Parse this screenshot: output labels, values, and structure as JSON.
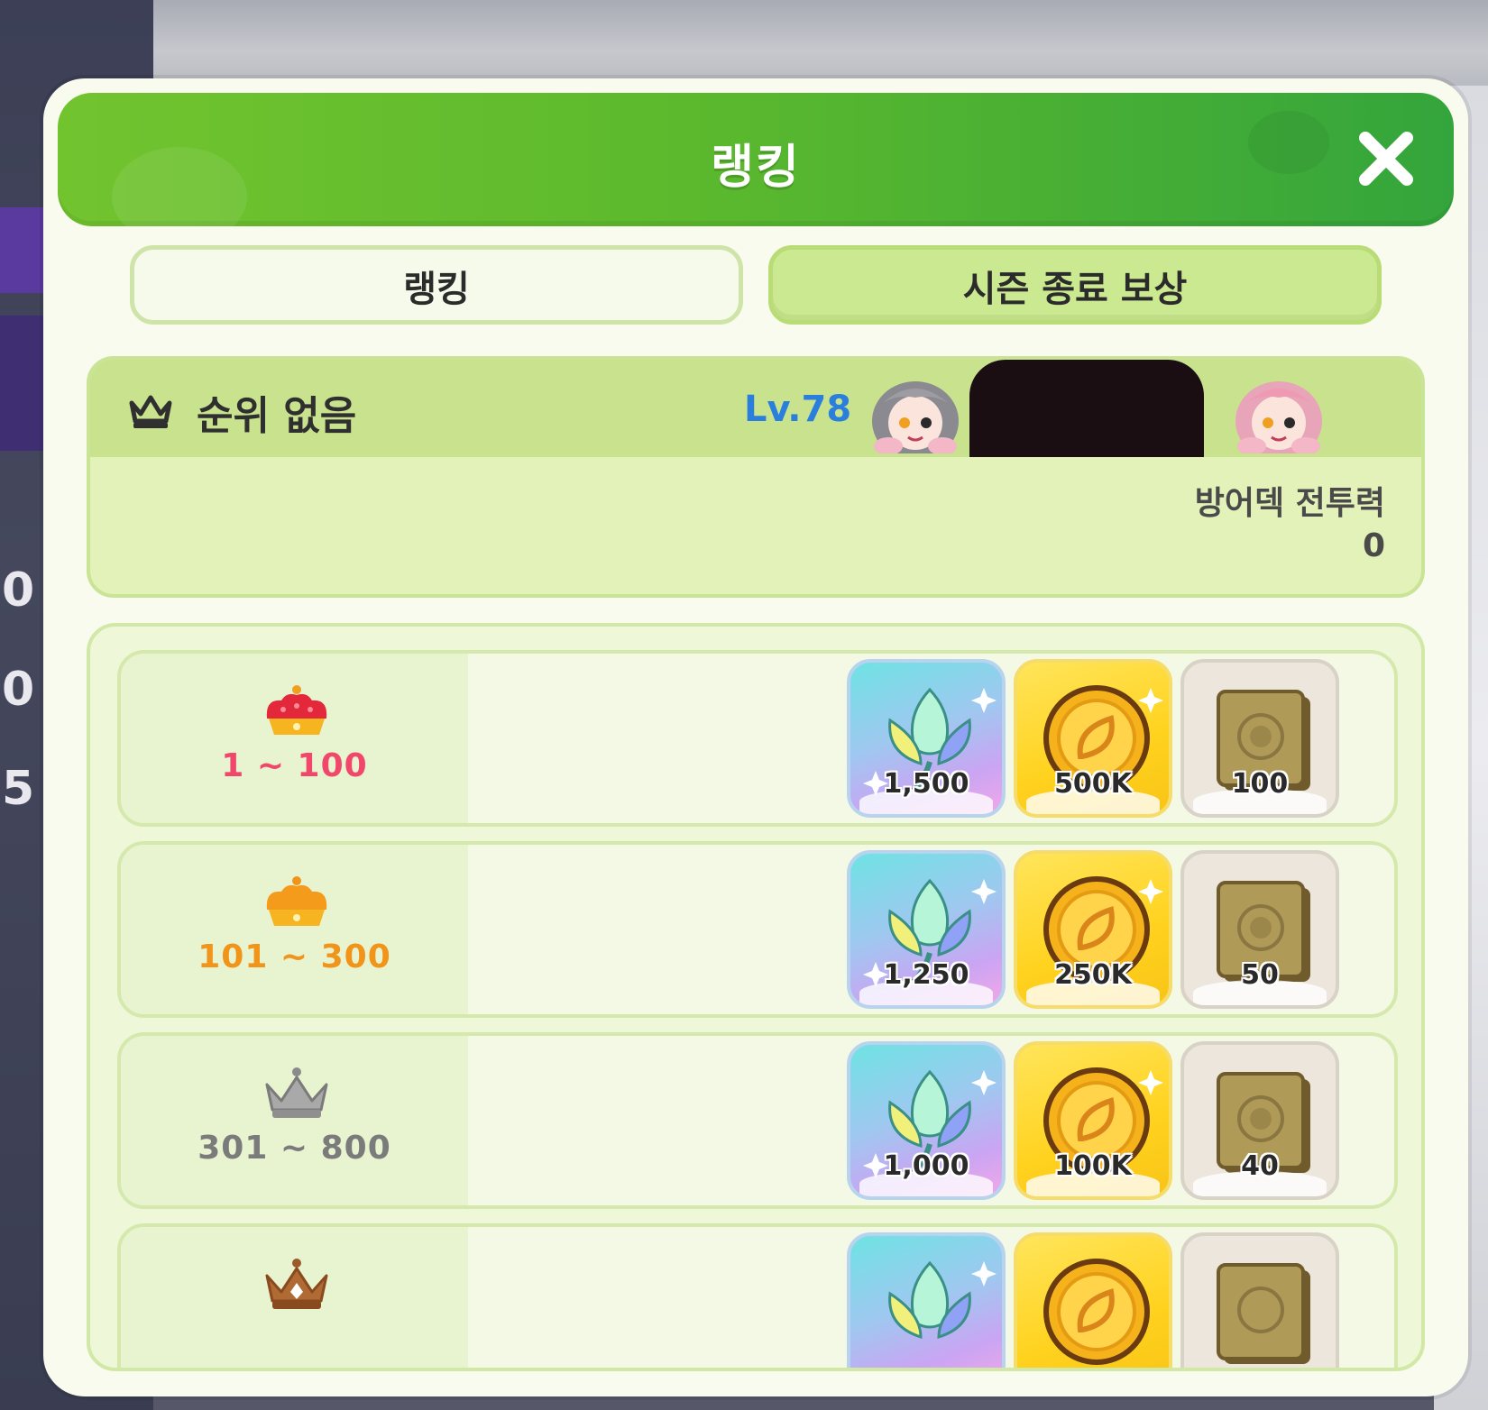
{
  "background": {
    "edge_numbers": [
      "0",
      "0",
      "5"
    ]
  },
  "header": {
    "title": "랭킹",
    "close_icon": "close-icon"
  },
  "tabs": [
    {
      "label": "랭킹",
      "selected": false
    },
    {
      "label": "시즌 종료 보상",
      "selected": true
    }
  ],
  "my_info": {
    "rank_icon": "crown-outline-icon",
    "rank_text": "순위 없음",
    "level": "Lv.78",
    "defense_power_label": "방어덱 전투력",
    "defense_power_value": "0"
  },
  "rewards": [
    {
      "tier": "1 ~ 100",
      "crown": "red-crown-icon",
      "color": "#f0476a",
      "items": [
        {
          "icon": "crystal-sprout-icon",
          "qty": "1,500"
        },
        {
          "icon": "gold-coin-icon",
          "qty": "500K"
        },
        {
          "icon": "book-icon",
          "qty": "100"
        }
      ]
    },
    {
      "tier": "101 ~ 300",
      "crown": "gold-crown-icon",
      "color": "#f0941a",
      "items": [
        {
          "icon": "crystal-sprout-icon",
          "qty": "1,250"
        },
        {
          "icon": "gold-coin-icon",
          "qty": "250K"
        },
        {
          "icon": "book-icon",
          "qty": "50"
        }
      ]
    },
    {
      "tier": "301 ~ 800",
      "crown": "silver-crown-icon",
      "color": "#7b7b7b",
      "items": [
        {
          "icon": "crystal-sprout-icon",
          "qty": "1,000"
        },
        {
          "icon": "gold-coin-icon",
          "qty": "100K"
        },
        {
          "icon": "book-icon",
          "qty": "40"
        }
      ]
    },
    {
      "tier": "",
      "crown": "bronze-crown-icon",
      "color": "#9a5a2a",
      "items": [
        {
          "icon": "crystal-sprout-icon",
          "qty": ""
        },
        {
          "icon": "gold-coin-icon",
          "qty": ""
        },
        {
          "icon": "book-icon",
          "qty": ""
        }
      ]
    }
  ],
  "colors": {
    "header_green": "#5cb92d",
    "panel_green": "#e2f2b8",
    "level_blue": "#2b7fdc"
  }
}
